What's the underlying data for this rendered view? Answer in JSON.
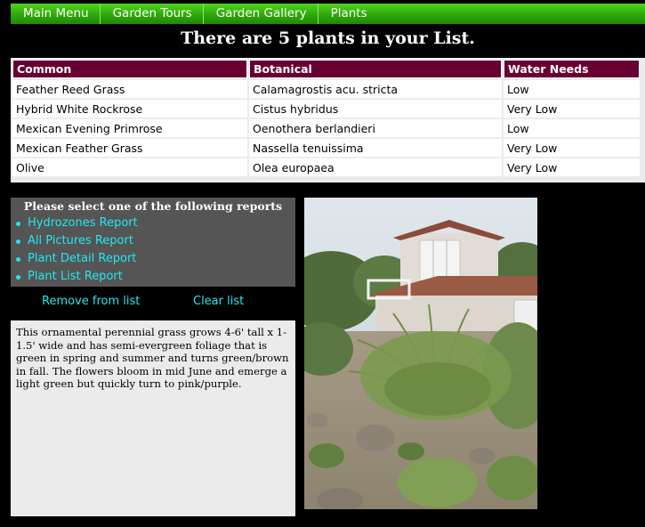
{
  "nav": {
    "items": [
      "Main Menu",
      "Garden Tours",
      "Garden Gallery",
      "Plants"
    ]
  },
  "headline": "There are 5 plants in your List.",
  "table": {
    "headers": [
      "Common",
      "Botanical",
      "Water Needs"
    ],
    "rows": [
      [
        "Feather Reed Grass",
        "Calamagrostis acu. stricta",
        "Low"
      ],
      [
        "Hybrid White Rockrose",
        "Cistus hybridus",
        "Very Low"
      ],
      [
        "Mexican Evening Primrose",
        "Oenothera berlandieri",
        "Low"
      ],
      [
        "Mexican Feather Grass",
        "Nassella tenuissima",
        "Very Low"
      ],
      [
        "Olive",
        "Olea europaea",
        "Very Low"
      ]
    ]
  },
  "reports": {
    "title": "Please select one of the following reports",
    "items": [
      "Hydrozones Report",
      "All Pictures Report",
      "Plant Detail Report",
      "Plant List Report"
    ]
  },
  "actions": {
    "remove": "Remove from list",
    "clear": "Clear list"
  },
  "description": "This ornamental perennial grass grows 4-6' tall x 1-1.5' wide and has semi-evergreen foliage that is green in spring and summer and turns green/brown in fall. The flowers bloom in mid June and emerge a light green but quickly turn to pink/purple.",
  "colors": {
    "nav_green": "#3cc012",
    "header_maroon": "#690032",
    "link_cyan": "#20e8f0",
    "panel_gray": "#555555"
  }
}
